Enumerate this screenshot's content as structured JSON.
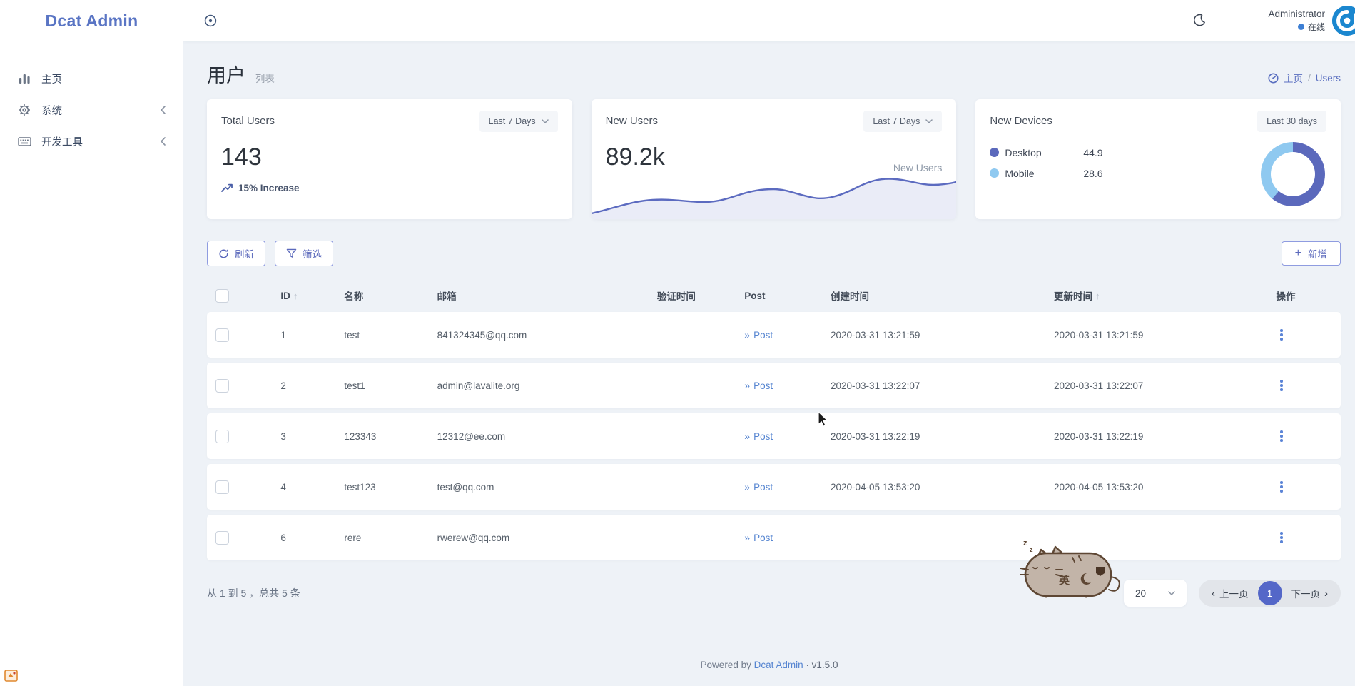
{
  "sidebar": {
    "logo": "Dcat Admin",
    "items": [
      {
        "label": "主页",
        "icon": "bar-chart-icon"
      },
      {
        "label": "系统",
        "icon": "gear-icon",
        "has_children": true
      },
      {
        "label": "开发工具",
        "icon": "keyboard-icon",
        "has_children": true
      }
    ]
  },
  "topbar": {
    "user_name": "Administrator",
    "user_status": "在线"
  },
  "page": {
    "title": "用户",
    "subtitle": "列表",
    "breadcrumb_home": "主页",
    "breadcrumb_sep": "/",
    "breadcrumb_current": "Users"
  },
  "cards": {
    "total_users": {
      "title": "Total Users",
      "range": "Last 7 Days",
      "value": "143",
      "trend": "15% Increase"
    },
    "new_users": {
      "title": "New Users",
      "range": "Last 7 Days",
      "value": "89.2k",
      "series_label": "New Users"
    },
    "new_devices": {
      "title": "New Devices",
      "range": "Last 30 days",
      "legend": [
        {
          "label": "Desktop",
          "value": "44.9",
          "color": "#5b69bc"
        },
        {
          "label": "Mobile",
          "value": "28.6",
          "color": "#8fc9f0"
        }
      ]
    }
  },
  "chart_data": [
    {
      "type": "area",
      "title": "New Users sparkline (Last 7 Days)",
      "x": [
        1,
        2,
        3,
        4,
        5,
        6,
        7,
        8
      ],
      "series": [
        {
          "name": "New Users",
          "values": [
            10,
            36,
            33,
            46,
            58,
            42,
            80,
            72
          ]
        }
      ],
      "color": "#5c6bc0",
      "note": "unlabeled sparkline, values estimated from pixels",
      "legend_position": "top-right",
      "grid": false
    },
    {
      "type": "pie",
      "title": "New Devices (Last 30 days)",
      "categories": [
        "Desktop",
        "Mobile"
      ],
      "values": [
        44.9,
        28.6
      ],
      "colors": [
        "#5b69bc",
        "#8fc9f0"
      ]
    }
  ],
  "toolbar": {
    "refresh_label": "刷新",
    "filter_label": "筛选",
    "create_label": "新增"
  },
  "table": {
    "columns": {
      "id": "ID",
      "name": "名称",
      "email": "邮箱",
      "verified_at": "验证时间",
      "post": "Post",
      "created_at": "创建时间",
      "updated_at": "更新时间",
      "actions": "操作"
    },
    "rows": [
      {
        "id": "1",
        "name": "test",
        "email": "841324345@qq.com",
        "verified_at": "",
        "post": "Post",
        "created_at": "2020-03-31 13:21:59",
        "updated_at": "2020-03-31 13:21:59"
      },
      {
        "id": "2",
        "name": "test1",
        "email": "admin@lavalite.org",
        "verified_at": "",
        "post": "Post",
        "created_at": "2020-03-31 13:22:07",
        "updated_at": "2020-03-31 13:22:07"
      },
      {
        "id": "3",
        "name": "123343",
        "email": "12312@ee.com",
        "verified_at": "",
        "post": "Post",
        "created_at": "2020-03-31 13:22:19",
        "updated_at": "2020-03-31 13:22:19"
      },
      {
        "id": "4",
        "name": "test123",
        "email": "test@qq.com",
        "verified_at": "",
        "post": "Post",
        "created_at": "2020-04-05 13:53:20",
        "updated_at": "2020-04-05 13:53:20"
      },
      {
        "id": "6",
        "name": "rere",
        "email": "rwerew@qq.com",
        "verified_at": "",
        "post": "Post",
        "created_at": "",
        "updated_at": ""
      }
    ]
  },
  "pagination": {
    "summary": "从 1 到 5 ，总共 5 条",
    "page_size": "20",
    "prev_label": "上一页",
    "current_page": "1",
    "next_label": "下一页"
  },
  "footer": {
    "powered_by": "Powered by",
    "brand_link": "Dcat Admin",
    "separator": "·",
    "version": "v1.5.0"
  },
  "colors": {
    "primary": "#5b69bc",
    "link": "#5685d1",
    "page_background": "#eef2f7",
    "avatar_blue": "#1b87cf",
    "online_dot": "#3d7fd4"
  }
}
